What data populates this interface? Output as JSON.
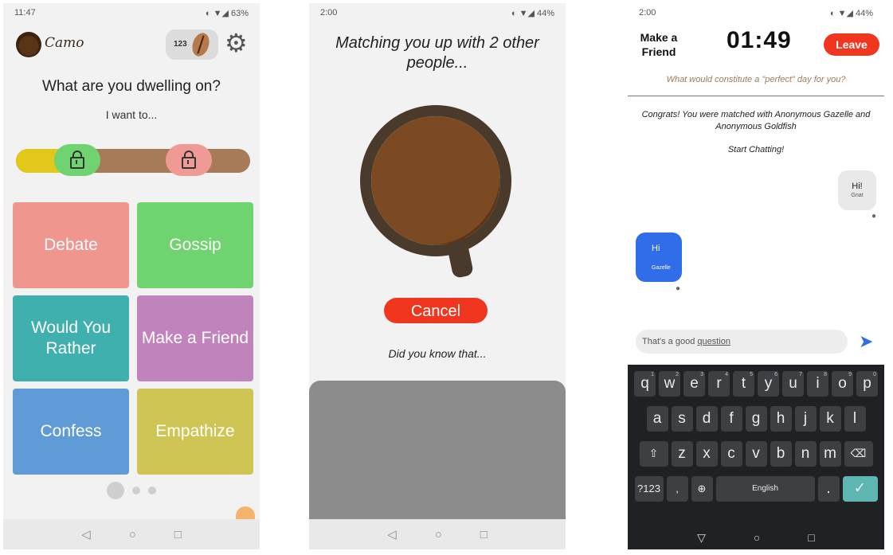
{
  "screen1": {
    "status": {
      "time": "11:47",
      "icons": "◐ ▼◢ 63%"
    },
    "app_name": "Camo",
    "beans_count": "123",
    "question": "What are you dwelling on?",
    "want_to": "I want to...",
    "slider": {
      "left_fraction": 0.2
    },
    "tiles": [
      {
        "label": "Debate",
        "color": "#f0968f"
      },
      {
        "label": "Gossip",
        "color": "#6fd36f"
      },
      {
        "label": "Would You Rather",
        "color": "#3fb0ad"
      },
      {
        "label": "Make a Friend",
        "color": "#c183bb"
      },
      {
        "label": "Confess",
        "color": "#5f9bd6"
      },
      {
        "label": "Empathize",
        "color": "#cfc554"
      }
    ],
    "nav": [
      "◁",
      "○",
      "□"
    ]
  },
  "screen2": {
    "status": {
      "time": "2:00",
      "icons": "◐ ▼◢ 44%"
    },
    "matching_text": "Matching you up with 2 other people...",
    "cancel_label": "Cancel",
    "did_you_know": "Did you know that...",
    "nav": [
      "◁",
      "○",
      "□"
    ]
  },
  "screen3": {
    "status": {
      "time": "2:00",
      "icons": "◐ ▼◢ 44%"
    },
    "title": "Make a Friend",
    "timer": "01:49",
    "leave_label": "Leave",
    "prompt": "What would constitute a \"perfect\" day for you?",
    "congrats": "Congrats! You were matched with Anonymous Gazelle and Anonymous Goldfish",
    "start_chatting": "Start Chatting!",
    "messages": [
      {
        "text": "Hi!",
        "sender": "Gnat"
      },
      {
        "text": "Hi",
        "sender": "Gazelle"
      }
    ],
    "input": {
      "value_prefix": "That's a good ",
      "value_underlined": "question"
    },
    "keyboard": {
      "row1": [
        {
          "k": "q",
          "n": "1"
        },
        {
          "k": "w",
          "n": "2"
        },
        {
          "k": "e",
          "n": "3"
        },
        {
          "k": "r",
          "n": "4"
        },
        {
          "k": "t",
          "n": "5"
        },
        {
          "k": "y",
          "n": "6"
        },
        {
          "k": "u",
          "n": "7"
        },
        {
          "k": "i",
          "n": "8"
        },
        {
          "k": "o",
          "n": "9"
        },
        {
          "k": "p",
          "n": "0"
        }
      ],
      "row2": [
        "a",
        "s",
        "d",
        "f",
        "g",
        "h",
        "j",
        "k",
        "l"
      ],
      "row3": [
        "z",
        "x",
        "c",
        "v",
        "b",
        "n",
        "m"
      ],
      "symbols_key": "?123",
      "space_label": "English",
      "period": "."
    },
    "nav": [
      "▽",
      "○",
      "□"
    ]
  },
  "colors": {
    "accent_red": "#f0361f",
    "chat_blue": "#2f6ee8",
    "keyboard_bg": "#202124"
  }
}
